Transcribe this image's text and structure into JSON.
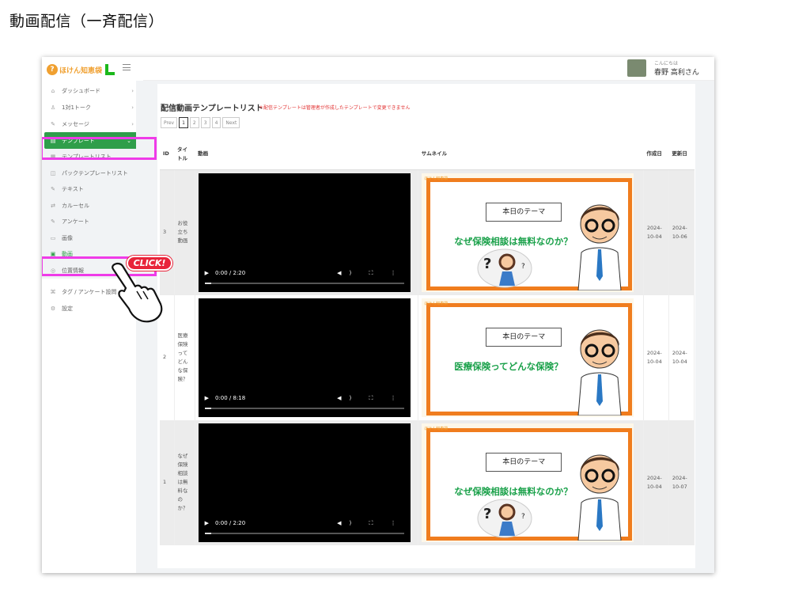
{
  "heading": "動画配信（一斉配信）",
  "brand": {
    "logo_text": "ほけん知恵袋"
  },
  "user": {
    "greeting": "こんにちは",
    "name": "春野 高利さん"
  },
  "sidebar": {
    "items": [
      {
        "label": "ダッシュボード",
        "icon": "home-icon",
        "chevron": "›"
      },
      {
        "label": "1対1トーク",
        "icon": "users-icon",
        "chevron": "›"
      },
      {
        "label": "メッセージ",
        "icon": "edit-icon",
        "chevron": "›"
      },
      {
        "label": "テンプレート",
        "icon": "template-icon",
        "chevron": "⌄"
      }
    ],
    "sub_items": [
      {
        "label": "テンプレートリスト",
        "icon": "list-icon"
      },
      {
        "label": "パックテンプレートリスト",
        "icon": "pack-icon"
      },
      {
        "label": "テキスト",
        "icon": "edit-icon"
      },
      {
        "label": "カルーセル",
        "icon": "carousel-icon"
      },
      {
        "label": "アンケート",
        "icon": "survey-icon"
      },
      {
        "label": "画像",
        "icon": "image-icon"
      },
      {
        "label": "動画",
        "icon": "video-icon"
      },
      {
        "label": "位置情報",
        "icon": "location-icon"
      }
    ],
    "bottom_items": [
      {
        "label": "タグ / アンケート設問",
        "icon": "tag-icon",
        "chevron": "›"
      },
      {
        "label": "設定",
        "icon": "gear-icon",
        "chevron": "›"
      }
    ]
  },
  "annotation": {
    "click_label": "CLICK!"
  },
  "list": {
    "title": "配信動画テンプレートリスト",
    "note": "＊配信テンプレートは管理者が作成したテンプレートで変更できません",
    "pager": [
      "Prev",
      "1",
      "2",
      "3",
      "4",
      "Next"
    ],
    "columns": {
      "id": "ID",
      "title": "タイトル",
      "video": "動画",
      "thumbnail": "サムネイル",
      "created": "作成日",
      "updated": "更新日"
    },
    "rows": [
      {
        "id": "3",
        "title": "お役立ち動画",
        "time": "0:00 / 2:20",
        "theme": "本日のテーマ",
        "caption": "なぜ保険相談は無料なのか？",
        "created": "2024-10-04",
        "updated": "2024-10-06"
      },
      {
        "id": "2",
        "title": "医療保険ってどんな保険？",
        "time": "0:00 / 8:18",
        "theme": "本日のテーマ",
        "caption": "医療保険ってどんな保険？",
        "created": "2024-10-04",
        "updated": "2024-10-04"
      },
      {
        "id": "1",
        "title": "なぜ保険相談は無料なのか？",
        "time": "0:00 / 2:20",
        "theme": "本日のテーマ",
        "caption": "なぜ保険相談は無料なのか？",
        "created": "2024-10-04",
        "updated": "2024-10-07"
      }
    ]
  },
  "colors": {
    "accent": "#2f9e4a",
    "highlight": "#ef3be8",
    "badge": "#e8243a",
    "board": "#f07d1e"
  }
}
